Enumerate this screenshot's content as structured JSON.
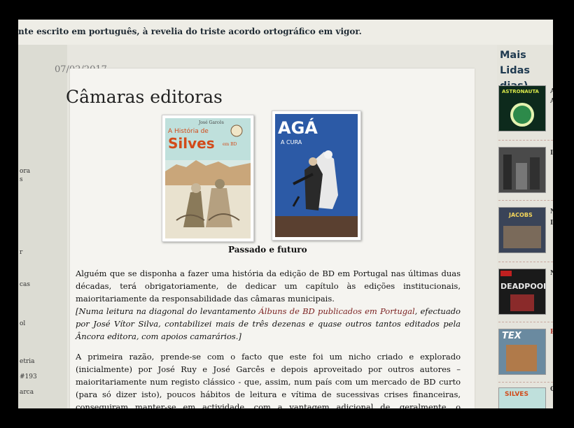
{
  "header": {
    "tagline": "nte escrito em português, à revelia do triste acordo ortográfico em vigor."
  },
  "left_sidebar": {
    "fragments": [
      "ora",
      "s",
      "r",
      "cas",
      "ol",
      "etria",
      "#193",
      "arca"
    ]
  },
  "post": {
    "date": "07/02/2017",
    "title": "Câmaras editoras",
    "cover1": {
      "small_author": "José Garcês",
      "title_line1": "A História de",
      "title_line2": "Silves",
      "title_suffix": "em BD"
    },
    "cover2": {
      "title": "AGÁ",
      "subtitle": "A CURA"
    },
    "caption": "Passado e futuro",
    "p1": "Alguém que se disponha a fazer uma história da edição de BD em Portugal nas últimas duas décadas, terá obrigatoriamente, de dedicar um capítulo às edições institucionais, maioritariamente da responsabilidade das câmaras municipais.",
    "p2_prefix": "[Numa leitura na diagonal do levantamento ",
    "p2_link": "Álbuns de BD publicados em Portugal",
    "p2_suffix": ", efectuado por José Vítor Silva, contabilizei mais de três dezenas e quase outros tantos editados pela Âncora editora, com apoios camarários.]",
    "p3": "A primeira razão, prende-se com o facto que este foi um nicho criado e explorado (inicialmente) por José Ruy e José Garcês e depois aproveitado por outros autores –maioritariamente num registo clássico - que, assim, num país com um mercado de BD curto (para só dizer isto), poucos hábitos de leitura e vítima de sucessivas crises financeiras, conseguiram manter-se em actividade, com a vantagem adicional de, geralmente, o pagamento destes trabalhos não estar dependente das vendas."
  },
  "right_sidebar": {
    "heading_line1": "Mais Lidas",
    "heading_line2": "dias)",
    "thumbs": [
      {
        "label": "ASTRONAUTA",
        "icon": "astronauta-cover-icon"
      },
      {
        "label": "",
        "icon": "city-comic-cover-icon"
      },
      {
        "label": "JACOBS",
        "icon": "jacobs-cover-icon"
      },
      {
        "label": "DEADPOOL",
        "icon": "deadpool-cover-icon"
      },
      {
        "label": "TEX",
        "icon": "tex-cover-icon"
      },
      {
        "label": "SILVES",
        "icon": "silves-small-cover-icon"
      }
    ],
    "edge_letters": [
      "A",
      "A",
      "I",
      "N",
      "I",
      "N",
      "E",
      "C"
    ]
  },
  "colors": {
    "link": "#7a1f1f",
    "heading": "#1f3a50",
    "accent": "#b03a2e"
  }
}
